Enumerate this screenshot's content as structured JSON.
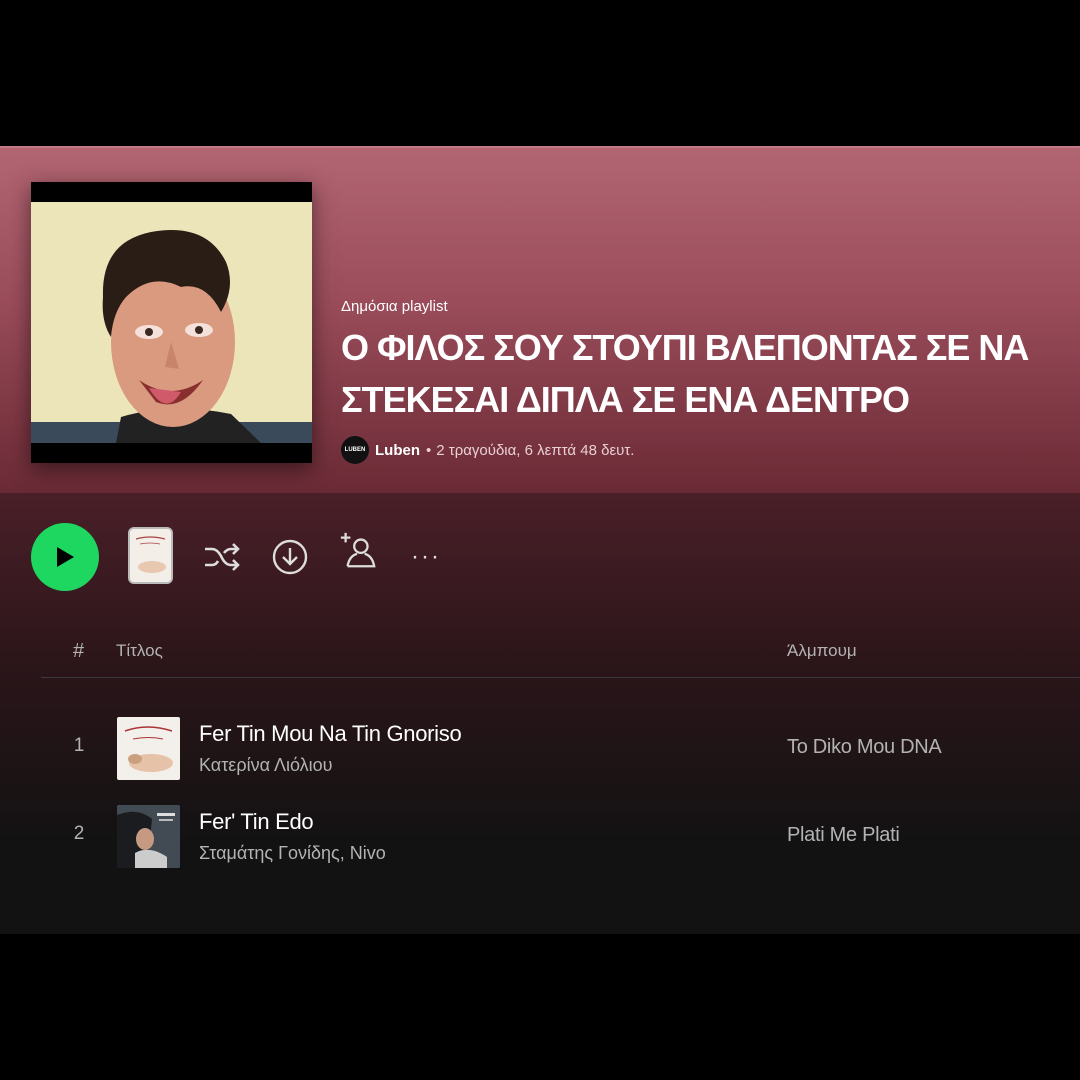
{
  "header": {
    "type_label": "Δημόσια playlist",
    "title": "Ο ΦΙΛΟΣ ΣΟΥ ΣΤΟΥΠΙ ΒΛΕΠΟΝΤΑΣ ΣΕ ΝΑ ΣΤΕΚΕΣΑΙ ΔΙΠΛΑ ΣΕ ΕΝΑ ΔΕΝΤΡΟ",
    "owner_avatar_text": "LUBEN",
    "owner": "Luben",
    "separator": "•",
    "stats": "2 τραγούδια, 6 λεπτά 48 δευτ."
  },
  "actions": {
    "play_icon": "play-icon",
    "shuffle_icon": "shuffle-icon",
    "download_icon": "download-icon",
    "add_user_icon": "add-user-icon",
    "more_icon": "more-icon",
    "more_label": "···"
  },
  "table": {
    "columns": {
      "number": "#",
      "title": "Τίτλος",
      "album": "Άλμπουμ"
    },
    "tracks": [
      {
        "number": "1",
        "title": "Fer Tin Mou Na Tin Gnoriso",
        "artist": "Κατερίνα Λιόλιου",
        "album": "To Diko Mou DNA"
      },
      {
        "number": "2",
        "title": "Fer' Tin Edo",
        "artist": "Σταμάτης Γονίδης, Nivo",
        "album": "Plati Me Plati"
      }
    ]
  },
  "colors": {
    "accent": "#1ed760",
    "header_top": "#b26572",
    "header_bottom": "#6a2a35",
    "background": "#121212"
  }
}
